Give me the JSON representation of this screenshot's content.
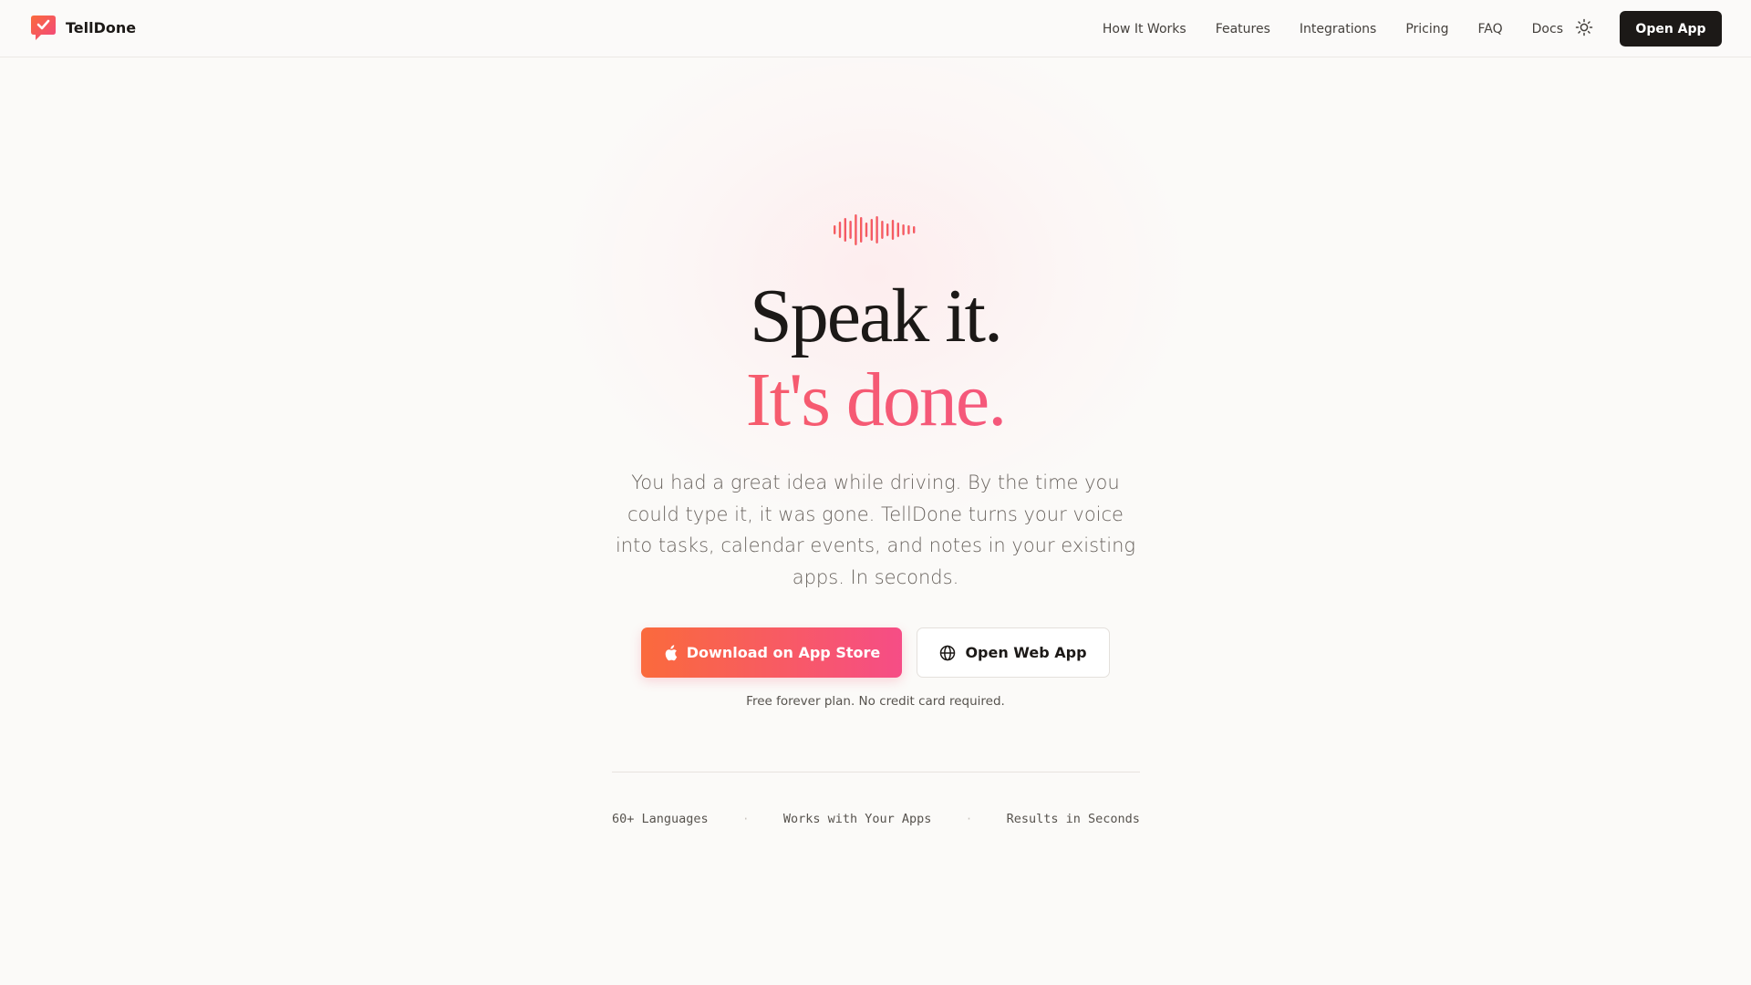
{
  "brand": {
    "name": "TellDone",
    "logo_icon": "chat-check-icon"
  },
  "nav": {
    "links": [
      "How It Works",
      "Features",
      "Integrations",
      "Pricing",
      "FAQ",
      "Docs"
    ],
    "theme_icon": "sun-icon",
    "open_app_label": "Open App"
  },
  "hero": {
    "wave_icon": "sound-wave-icon",
    "headline_line1": "Speak it.",
    "headline_line2": "It's done.",
    "subtitle": "You had a great idea while driving. By the time you could type it, it was gone. TellDone turns your voice into tasks, calendar events, and notes in your existing apps. In seconds.",
    "primary_button": {
      "label": "Download on App Store",
      "icon": "apple-icon"
    },
    "secondary_button": {
      "label": "Open Web App",
      "icon": "globe-icon"
    },
    "note": "Free forever plan. No credit card required."
  },
  "features": {
    "items": [
      "60+ Languages",
      "Works with Your Apps",
      "Results in Seconds"
    ],
    "separator": "·"
  },
  "colors": {
    "background": "#fbfaf8",
    "text": "#1c1917",
    "accent_start": "#fa6a3c",
    "accent_end": "#f64d86",
    "dark_button": "#1c1917"
  }
}
